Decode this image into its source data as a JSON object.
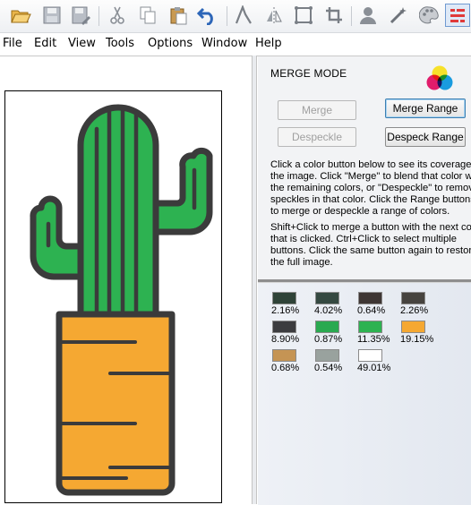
{
  "menu": {
    "items": [
      "File",
      "Edit",
      "View",
      "Tools",
      "Options",
      "Window",
      "Help"
    ]
  },
  "toolbar": {
    "icons": [
      "open-folder-icon",
      "save-icon",
      "save-as-icon",
      "cut-icon",
      "copy-icon",
      "paste-icon",
      "undo-icon",
      "trace-icon",
      "flip-icon",
      "crop-shape-icon",
      "crop-icon",
      "user-icon",
      "magic-wand-icon",
      "palette-icon",
      "merge-mode-icon"
    ]
  },
  "panel": {
    "title": "MERGE MODE",
    "buttons": {
      "merge": "Merge",
      "merge_range": "Merge Range",
      "despeckle": "Despeckle",
      "despeck_range": "Despeck Range"
    },
    "help_lines_1": [
      "Click a color button below to see its coverage in",
      "the image. Click \"Merge\" to blend that color with",
      "the remaining colors, or \"Despeckle\" to remove",
      "speckles in that color. Click the Range buttons",
      "to merge or despeckle a range of colors."
    ],
    "help_lines_2": [
      "Shift+Click to merge a button with the next color",
      "that is clicked. Ctrl+Click to select multiple",
      "buttons. Click the same button again to restore",
      "the full image."
    ]
  },
  "swatches": [
    {
      "color": "#2f4338",
      "percent": "2.16%"
    },
    {
      "color": "#354941",
      "percent": "4.02%"
    },
    {
      "color": "#3e3634",
      "percent": "0.64%"
    },
    {
      "color": "#46433f",
      "percent": "2.26%"
    },
    {
      "color": "#3c3c3f",
      "percent": "8.90%"
    },
    {
      "color": "#2aa950",
      "percent": "0.87%"
    },
    {
      "color": "#2db251",
      "percent": "11.35%"
    },
    {
      "color": "#f5a832",
      "percent": "19.15%"
    },
    {
      "color": "#c59454",
      "percent": "0.68%"
    },
    {
      "color": "#99a29e",
      "percent": "0.54%"
    },
    {
      "color": "#ffffff",
      "percent": "49.01%"
    }
  ],
  "colors": {
    "outline": "#3b3b3b",
    "cactus_green": "#2db251",
    "pot_orange": "#f5a832"
  }
}
